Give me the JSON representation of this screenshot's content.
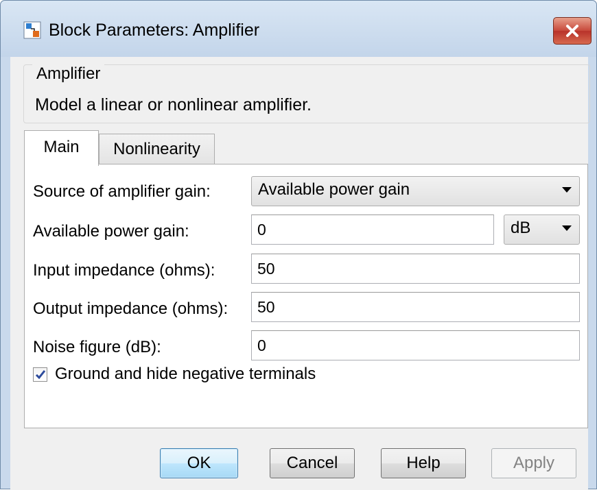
{
  "window": {
    "title": "Block Parameters: Amplifier"
  },
  "group": {
    "label": "Amplifier",
    "description": "Model a linear or nonlinear amplifier."
  },
  "tabs": [
    {
      "label": "Main",
      "selected": true
    },
    {
      "label": "Nonlinearity",
      "selected": false
    }
  ],
  "main": {
    "source_gain": {
      "label": "Source of amplifier gain:",
      "value": "Available power gain"
    },
    "power_gain": {
      "label": "Available power gain:",
      "value": "0",
      "unit": "dB"
    },
    "input_impedance": {
      "label": "Input impedance (ohms):",
      "value": "50"
    },
    "output_impedance": {
      "label": "Output impedance (ohms):",
      "value": "50"
    },
    "noise_figure": {
      "label": "Noise figure (dB):",
      "value": "0"
    },
    "ground_checkbox": {
      "label": "Ground and hide negative terminals",
      "checked": true
    }
  },
  "buttons": {
    "ok": "OK",
    "cancel": "Cancel",
    "help": "Help",
    "apply": "Apply"
  },
  "icons": {
    "title_icon": "simulink-block-icon",
    "close_icon": "close-icon",
    "dropdown_icon": "dropdown-arrow-icon",
    "check_icon": "checkmark-icon"
  },
  "colors": {
    "title_bar": "#c9d9ec",
    "close_button": "#c7483a",
    "ok_button": "#bee6fd",
    "checkmark": "#2c4a9c"
  }
}
